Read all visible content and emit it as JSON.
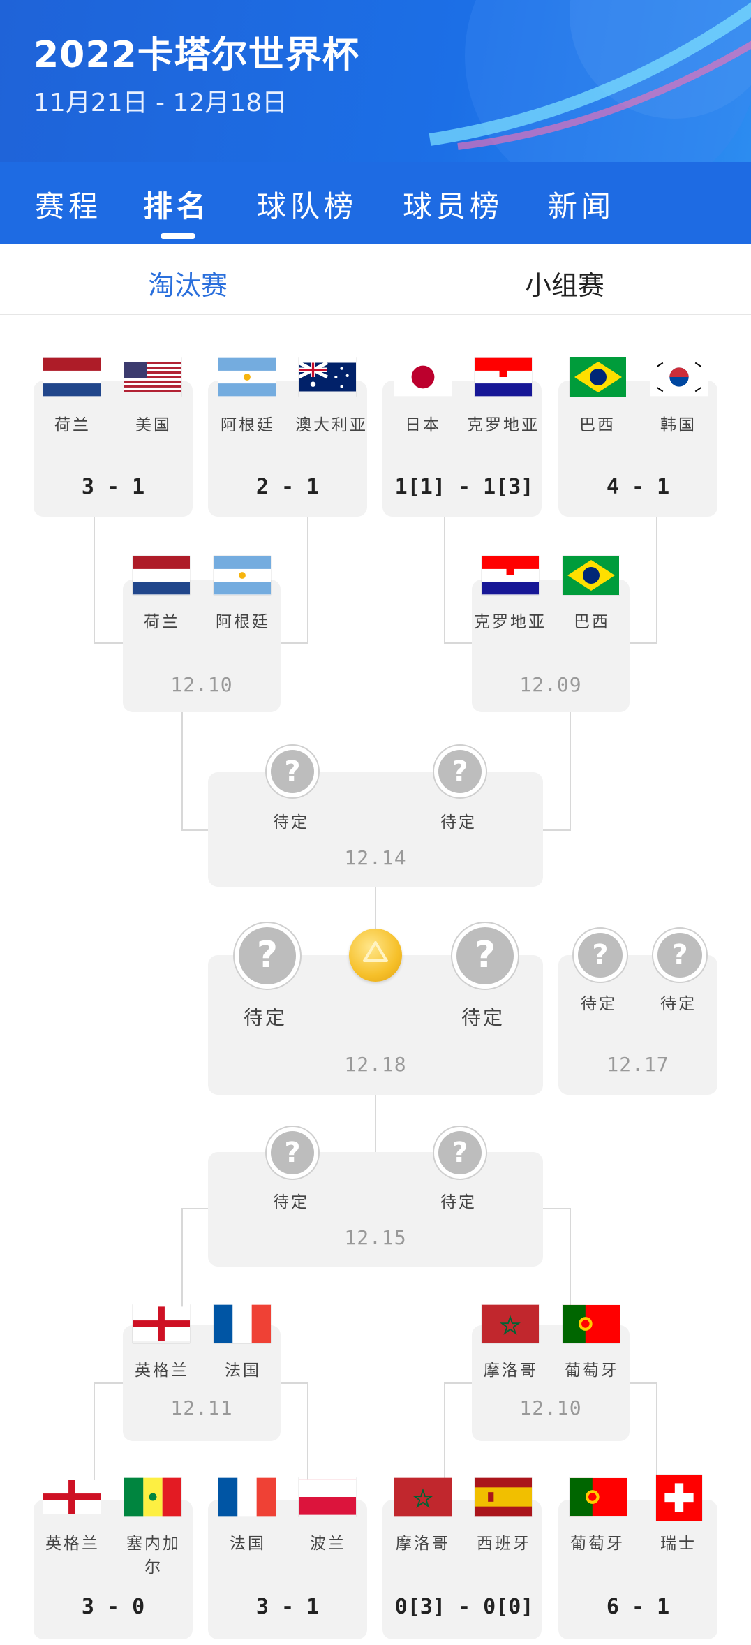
{
  "header": {
    "title": "2022卡塔尔世界杯",
    "dates": "11月21日 - 12月18日"
  },
  "tabs": [
    "赛程",
    "排名",
    "球队榜",
    "球员榜",
    "新闻"
  ],
  "active_tab": "排名",
  "subtabs": [
    "淘汰赛",
    "小组赛"
  ],
  "active_subtab": "淘汰赛",
  "colors": {
    "brand_blue": "#1e6be3",
    "active_subtab": "#2a6fdc",
    "card_bg": "#f2f2f2"
  },
  "round_of_16": [
    {
      "team1": "荷兰",
      "team2": "美国",
      "score": "3 - 1"
    },
    {
      "team1": "阿根廷",
      "team2": "澳大利亚",
      "score": "2 - 1"
    },
    {
      "team1": "日本",
      "team2": "克罗地亚",
      "score": "1[1] - 1[3]"
    },
    {
      "team1": "巴西",
      "team2": "韩国",
      "score": "4 - 1"
    },
    {
      "team1": "英格兰",
      "team2": "塞内加尔",
      "score": "3 - 0"
    },
    {
      "team1": "法国",
      "team2": "波兰",
      "score": "3 - 1"
    },
    {
      "team1": "摩洛哥",
      "team2": "西班牙",
      "score": "0[3] - 0[0]"
    },
    {
      "team1": "葡萄牙",
      "team2": "瑞士",
      "score": "6 - 1"
    }
  ],
  "quarter_finals": [
    {
      "team1": "荷兰",
      "team2": "阿根廷",
      "date": "12.10"
    },
    {
      "team1": "克罗地亚",
      "team2": "巴西",
      "date": "12.09"
    },
    {
      "team1": "英格兰",
      "team2": "法国",
      "date": "12.11"
    },
    {
      "team1": "摩洛哥",
      "team2": "葡萄牙",
      "date": "12.10"
    }
  ],
  "semi_finals": [
    {
      "team1": "待定",
      "team2": "待定",
      "date": "12.14"
    },
    {
      "team1": "待定",
      "team2": "待定",
      "date": "12.15"
    }
  ],
  "final": {
    "team1": "待定",
    "team2": "待定",
    "date": "12.18"
  },
  "third_place": {
    "team1": "待定",
    "team2": "待定",
    "date": "12.17"
  },
  "icons": {
    "unknown_team": "question-mark-icon",
    "final": "trophy-ball-icon"
  }
}
